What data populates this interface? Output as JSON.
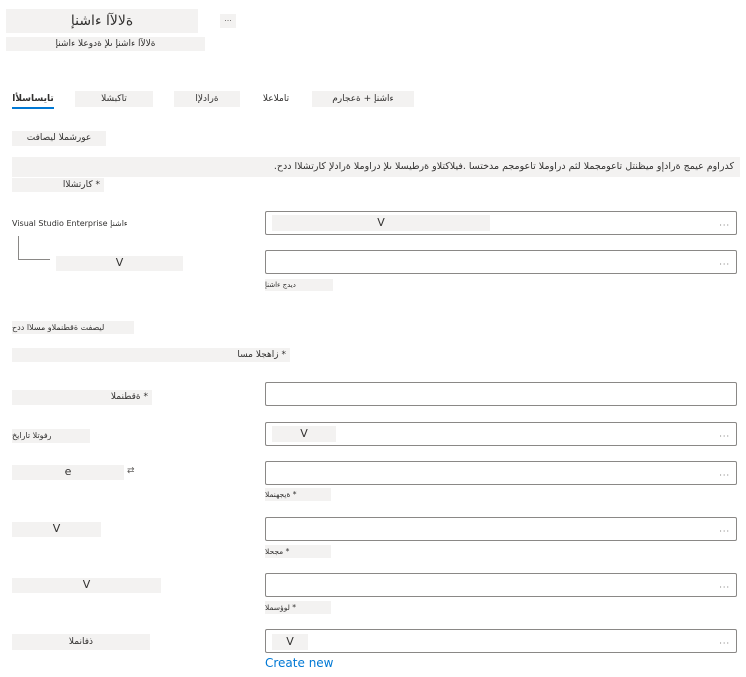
{
  "header": {
    "title": "ةلالآا ءاشنإ",
    "subtitle": "ةلالآا ءاشنإ ىلإ ةدوعلا ءاشنإ",
    "more_label": "..."
  },
  "tabs": [
    {
      "label": "تايساسلأا"
    },
    {
      "label": "تاكبشلا"
    },
    {
      "label": "ةرادلإا"
    },
    {
      "label": "تاملاعلا"
    },
    {
      "label": "ءاشنإ + ةعجارم"
    }
  ],
  "project": {
    "section_label": "عورشملا ليصافت",
    "description": ".كدراوم عيمج ةرادإو ميظنتل تاعومجملا لثم دراوملا تاعومجم مدختسا .فيلاكتلاو ةرطيسلا ىلإ دراوملا ةرادلإ كارتشلاا ددح",
    "subscription_label": "كارتشلاا *",
    "subscription_field_label": "Visual Studio Enterprise ءاشنإ",
    "subscription_value": "V",
    "subscription_dots": "...",
    "resource_group_value": "V",
    "resource_group_dots": "...",
    "resource_group_link": "ديدج ءاشنإ"
  },
  "instance": {
    "section_label": "ليصفت ةقطنملاو مسلاا ددح",
    "vm_name_label": "زاهجلا مسا *",
    "region_label": "ةقطنملا *",
    "availability_label": "رفوتلا تارايخ",
    "availability_value": "V",
    "availability_dots": "...",
    "image_value": "e",
    "image_icon": "⇄",
    "image_dots": "...",
    "image_hint": "ةيجهنملا *",
    "size_value": "V",
    "size_dots": "...",
    "size_hint": "مجحلا *",
    "admin_value": "V",
    "admin_dots": "...",
    "admin_hint": "لوؤسملا *",
    "ports_label": "ذفانملا",
    "ports_value": "V",
    "ports_dots": "...",
    "create_new": "Create new"
  }
}
